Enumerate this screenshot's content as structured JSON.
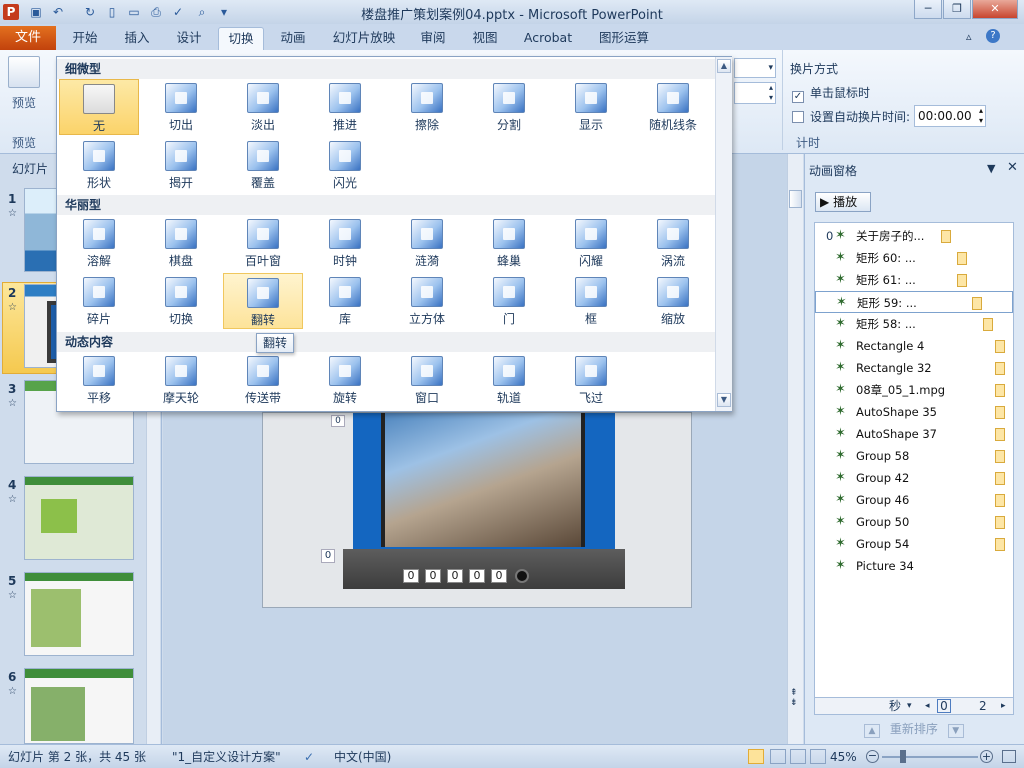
{
  "window": {
    "title": "楼盘推广策划案例04.pptx - Microsoft PowerPoint"
  },
  "tabs": [
    {
      "label": "文件"
    },
    {
      "label": "开始"
    },
    {
      "label": "插入"
    },
    {
      "label": "设计"
    },
    {
      "label": "切换"
    },
    {
      "label": "动画"
    },
    {
      "label": "幻灯片放映"
    },
    {
      "label": "审阅"
    },
    {
      "label": "视图"
    },
    {
      "label": "Acrobat"
    },
    {
      "label": "图形运算"
    }
  ],
  "ribbon": {
    "preview_label": "预览",
    "preview_group": "预览",
    "switch_mode": "换片方式",
    "on_click": "单击鼠标时",
    "on_click_checked": true,
    "auto_after": "设置自动换片时间:",
    "auto_after_checked": false,
    "auto_time": "00:00.00",
    "timing_group": "计时"
  },
  "gallery": {
    "sections": [
      {
        "title": "细微型",
        "items": [
          "无",
          "切出",
          "淡出",
          "推进",
          "擦除",
          "分割",
          "显示",
          "随机线条",
          "形状",
          "揭开",
          "覆盖",
          "闪光"
        ]
      },
      {
        "title": "华丽型",
        "items": [
          "溶解",
          "棋盘",
          "百叶窗",
          "时钟",
          "涟漪",
          "蜂巢",
          "闪耀",
          "涡流",
          "碎片",
          "切换",
          "翻转",
          "库",
          "立方体",
          "门",
          "框",
          "缩放"
        ]
      },
      {
        "title": "动态内容",
        "items": [
          "平移",
          "摩天轮",
          "传送带",
          "旋转",
          "窗口",
          "轨道",
          "飞过"
        ]
      }
    ],
    "selected": "无",
    "hovered": "翻转",
    "tooltip": "翻转"
  },
  "slides_pane": {
    "tab_label": "幻灯片",
    "slides": [
      {
        "num": "1"
      },
      {
        "num": "2"
      },
      {
        "num": "3"
      },
      {
        "num": "4"
      },
      {
        "num": "5"
      },
      {
        "num": "6"
      }
    ],
    "selected": "2"
  },
  "slide": {
    "counter_digits": [
      "0",
      "0",
      "0",
      "0",
      "0"
    ],
    "tags": [
      "0",
      "0"
    ]
  },
  "anim_pane": {
    "title": "动画窗格",
    "play_label": "播放",
    "items": [
      {
        "index": "0",
        "name": "关于房子的...",
        "bar": "mid"
      },
      {
        "index": "",
        "name": "矩形 60: ...",
        "bar": "mid"
      },
      {
        "index": "",
        "name": "矩形 61: ...",
        "bar": "mid"
      },
      {
        "index": "",
        "name": "矩形 59: ...",
        "bar": "mid"
      },
      {
        "index": "",
        "name": "矩形 58: ...",
        "bar": "mid"
      },
      {
        "index": "",
        "name": "Rectangle 4",
        "bar": "end"
      },
      {
        "index": "",
        "name": "Rectangle 32",
        "bar": "end"
      },
      {
        "index": "",
        "name": "08章_05_1.mpg",
        "bar": "end"
      },
      {
        "index": "",
        "name": "AutoShape 35",
        "bar": "end"
      },
      {
        "index": "",
        "name": "AutoShape 37",
        "bar": "end"
      },
      {
        "index": "",
        "name": "Group 58",
        "bar": "end"
      },
      {
        "index": "",
        "name": "Group 42",
        "bar": "end"
      },
      {
        "index": "",
        "name": "Group 46",
        "bar": "end"
      },
      {
        "index": "",
        "name": "Group 50",
        "bar": "end"
      },
      {
        "index": "",
        "name": "Group 54",
        "bar": "end"
      },
      {
        "index": "",
        "name": "Picture 34",
        "bar": "none"
      }
    ],
    "selected_index": 3,
    "timeline_unit": "秒",
    "timeline_start": "0",
    "timeline_end": "2",
    "reorder_label": "重新排序"
  },
  "status": {
    "slide_info": "幻灯片 第 2 张，共 45 张",
    "theme": "\"1_自定义设计方案\"",
    "language": "中文(中国)",
    "zoom": "45%"
  }
}
